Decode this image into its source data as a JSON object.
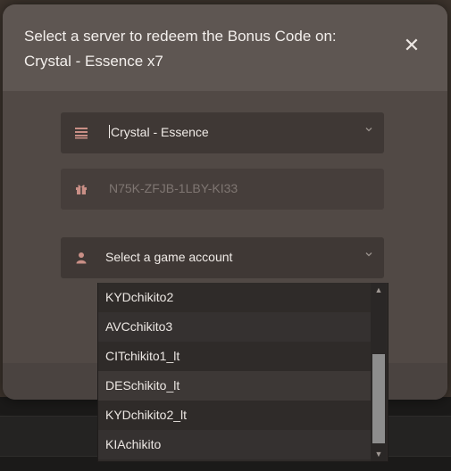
{
  "dialog": {
    "title": "Select a server to redeem the Bonus Code on: Crystal - Essence x7",
    "close_glyph": "✕"
  },
  "server_select": {
    "icon": "server-icon",
    "value": "Crystal - Essence"
  },
  "bonus_code": {
    "icon": "gift-icon",
    "value": "N75K-ZFJB-1LBY-KI33"
  },
  "account_select": {
    "icon": "user-icon",
    "placeholder": "Select a game account",
    "options": [
      "KYDchikito2",
      "AVCchikito3",
      "CITchikito1_lt",
      "DESchikito_lt",
      "KYDchikito2_lt",
      "KIAchikito"
    ]
  },
  "colors": {
    "modal_bg": "#514945",
    "field_bg": "#3f3835",
    "dropdown_bg": "#2f2b29",
    "icon_tint": "#c98f86"
  }
}
